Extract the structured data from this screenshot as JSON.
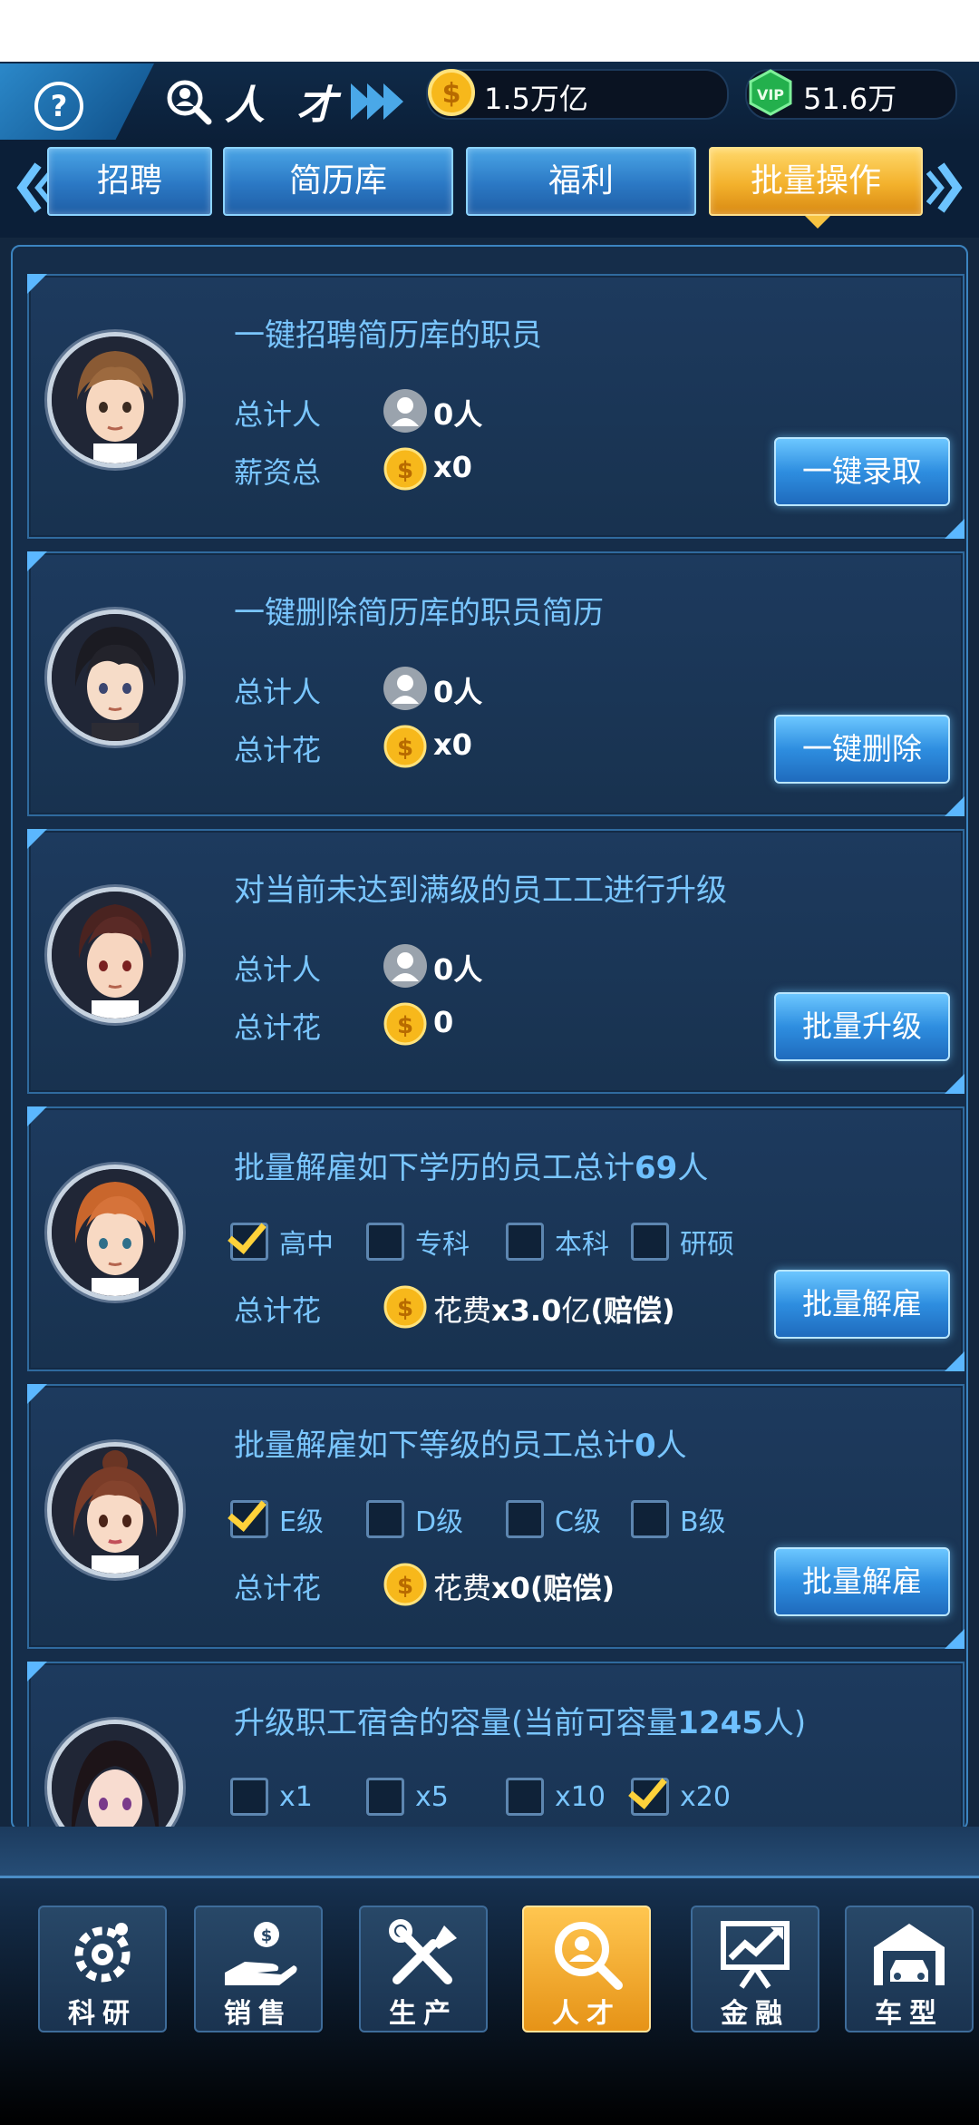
{
  "header": {
    "help_icon": "?",
    "title": "人 才",
    "gold": "1.5万亿",
    "gems": "51.6万"
  },
  "tabs": [
    {
      "label": "招聘",
      "active": false
    },
    {
      "label": "简历库",
      "active": false
    },
    {
      "label": "福利",
      "active": false
    },
    {
      "label": "批量操作",
      "active": true
    }
  ],
  "cards": [
    {
      "title": "一键招聘简历库的职员",
      "row1_label": "总计人",
      "row1_value": "0人",
      "row2_label": "薪资总",
      "row2_value": "x0",
      "button": "一键录取"
    },
    {
      "title": "一键删除简历库的职员简历",
      "row1_label": "总计人",
      "row1_value": "0人",
      "row2_label": "总计花",
      "row2_value": "x0",
      "button": "一键删除"
    },
    {
      "title": "对当前未达到满级的员工工进行升级",
      "row1_label": "总计人",
      "row1_value": "0人",
      "row2_label": "总计花",
      "row2_value": "0",
      "button": "批量升级"
    },
    {
      "title_pre": "批量解雇如下学历的员工总计",
      "title_num": "69",
      "title_post": "人",
      "options": [
        {
          "label": "高中",
          "checked": true
        },
        {
          "label": "专科",
          "checked": false
        },
        {
          "label": "本科",
          "checked": false
        },
        {
          "label": "研硕",
          "checked": false
        }
      ],
      "cost_label": "总计花",
      "cost_pre": "花费",
      "cost_num": "x3.0",
      "cost_unit": "亿",
      "cost_post": "(赔偿)",
      "button": "批量解雇"
    },
    {
      "title_pre": "批量解雇如下等级的员工总计",
      "title_num": "0",
      "title_post": "人",
      "options": [
        {
          "label": "E级",
          "checked": true
        },
        {
          "label": "D级",
          "checked": false
        },
        {
          "label": "C级",
          "checked": false
        },
        {
          "label": "B级",
          "checked": false
        }
      ],
      "cost_label": "总计花",
      "cost_pre": "花费",
      "cost_num": "x0",
      "cost_post": "(赔偿)",
      "button": "批量解雇"
    },
    {
      "title_pre": "升级职工宿舍的容量(当前可容量",
      "title_num": "1245",
      "title_post": "人)",
      "options": [
        {
          "label": "x1",
          "checked": false
        },
        {
          "label": "x5",
          "checked": false
        },
        {
          "label": "x10",
          "checked": false
        },
        {
          "label": "x20",
          "checked": true
        }
      ]
    }
  ],
  "bottom_nav": [
    {
      "label": "科研",
      "icon": "research-icon",
      "active": false
    },
    {
      "label": "销售",
      "icon": "sales-icon",
      "active": false
    },
    {
      "label": "生产",
      "icon": "production-icon",
      "active": false
    },
    {
      "label": "人才",
      "icon": "talent-icon",
      "active": true
    },
    {
      "label": "金融",
      "icon": "finance-icon",
      "active": false
    },
    {
      "label": "车型",
      "icon": "car-model-icon",
      "active": false
    }
  ],
  "colors": {
    "accent_blue": "#7ac6ff",
    "active_tab": "#f3b12c",
    "check_mark": "#ffd23a"
  }
}
